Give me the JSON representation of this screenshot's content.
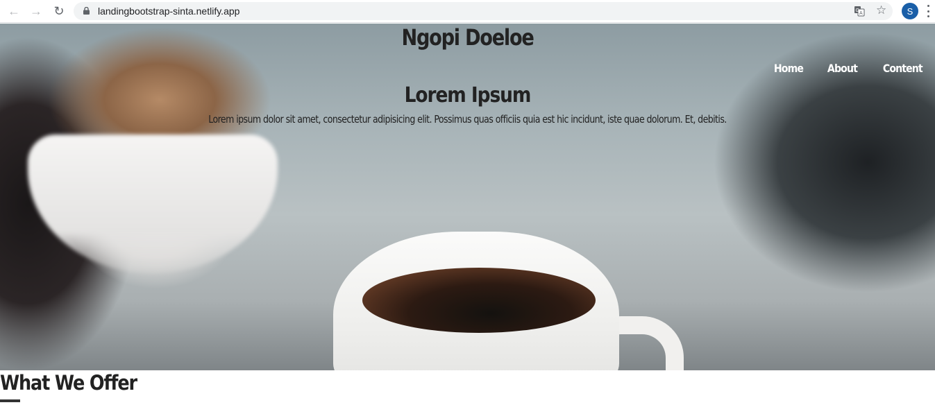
{
  "browser": {
    "url": "landingbootstrap-sinta.netlify.app",
    "profile_initial": "S",
    "icons": [
      "back-arrow-icon",
      "forward-arrow-icon",
      "reload-icon",
      "lock-icon",
      "translate-icon",
      "star-icon",
      "kebab-menu-icon"
    ],
    "accent_color": "#1a5fa8"
  },
  "site": {
    "title": "Ngopi Doeloe",
    "nav": [
      "Home",
      "About",
      "Content"
    ]
  },
  "hero": {
    "heading": "Lorem Ipsum",
    "text": "Lorem ipsum dolor sit amet, consectetur adipisicing elit. Possimus quas officiis quia est hic incidunt, iste quae dolorum. Et, debitis."
  },
  "section": {
    "title": "What We Offer"
  }
}
